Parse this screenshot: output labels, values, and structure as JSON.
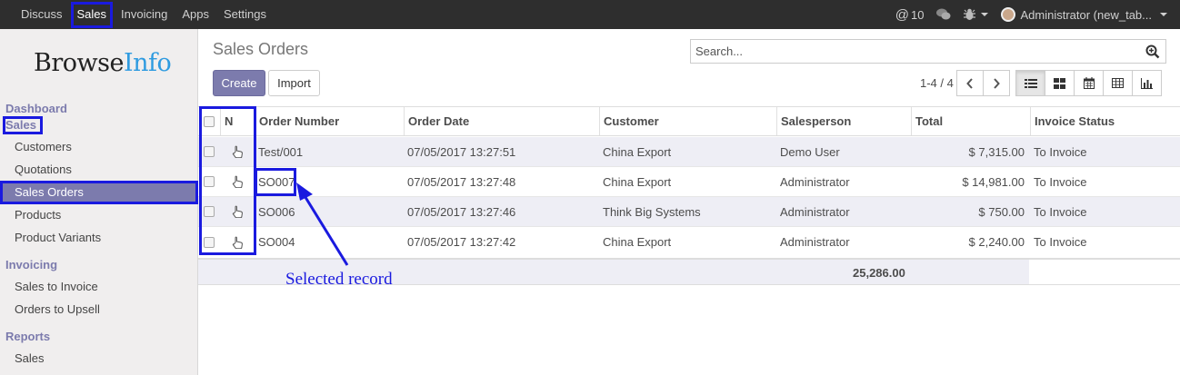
{
  "topbar": {
    "menu": [
      "Discuss",
      "Sales",
      "Invoicing",
      "Apps",
      "Settings"
    ],
    "active": "Sales",
    "mentions_count": "10",
    "user_label": "Administrator (new_tab..."
  },
  "sidebar": {
    "logo_browse": "Browse",
    "logo_info": "Info",
    "sections": [
      {
        "title": "Dashboard",
        "items": []
      },
      {
        "title": "Sales",
        "items": [
          "Customers",
          "Quotations",
          "Sales Orders",
          "Products",
          "Product Variants"
        ]
      },
      {
        "title": "Invoicing",
        "items": [
          "Sales to Invoice",
          "Orders to Upsell"
        ]
      },
      {
        "title": "Reports",
        "items": [
          "Sales"
        ]
      }
    ],
    "active_item": "Sales Orders"
  },
  "control": {
    "title": "Sales Orders",
    "search_placeholder": "Search...",
    "create_label": "Create",
    "import_label": "Import",
    "pager": "1-4 / 4"
  },
  "table": {
    "columns": [
      "N",
      "Order Number",
      "Order Date",
      "Customer",
      "Salesperson",
      "Total",
      "Invoice Status"
    ],
    "rows": [
      {
        "number": "Test/001",
        "date": "07/05/2017 13:27:51",
        "customer": "China Export",
        "salesperson": "Demo User",
        "total": "$ 7,315.00",
        "status": "To Invoice"
      },
      {
        "number": "SO007",
        "date": "07/05/2017 13:27:48",
        "customer": "China Export",
        "salesperson": "Administrator",
        "total": "$ 14,981.00",
        "status": "To Invoice"
      },
      {
        "number": "SO006",
        "date": "07/05/2017 13:27:46",
        "customer": "Think Big Systems",
        "salesperson": "Administrator",
        "total": "$ 750.00",
        "status": "To Invoice"
      },
      {
        "number": "SO004",
        "date": "07/05/2017 13:27:42",
        "customer": "China Export",
        "salesperson": "Administrator",
        "total": "$ 2,240.00",
        "status": "To Invoice"
      }
    ],
    "footer_total": "25,286.00"
  },
  "annotation": {
    "label": "Selected record"
  },
  "colors": {
    "accent": "#7c7bad",
    "highlight": "#1a1adf",
    "topbar": "#2e2e2e",
    "logo_info": "#2f9be0"
  }
}
